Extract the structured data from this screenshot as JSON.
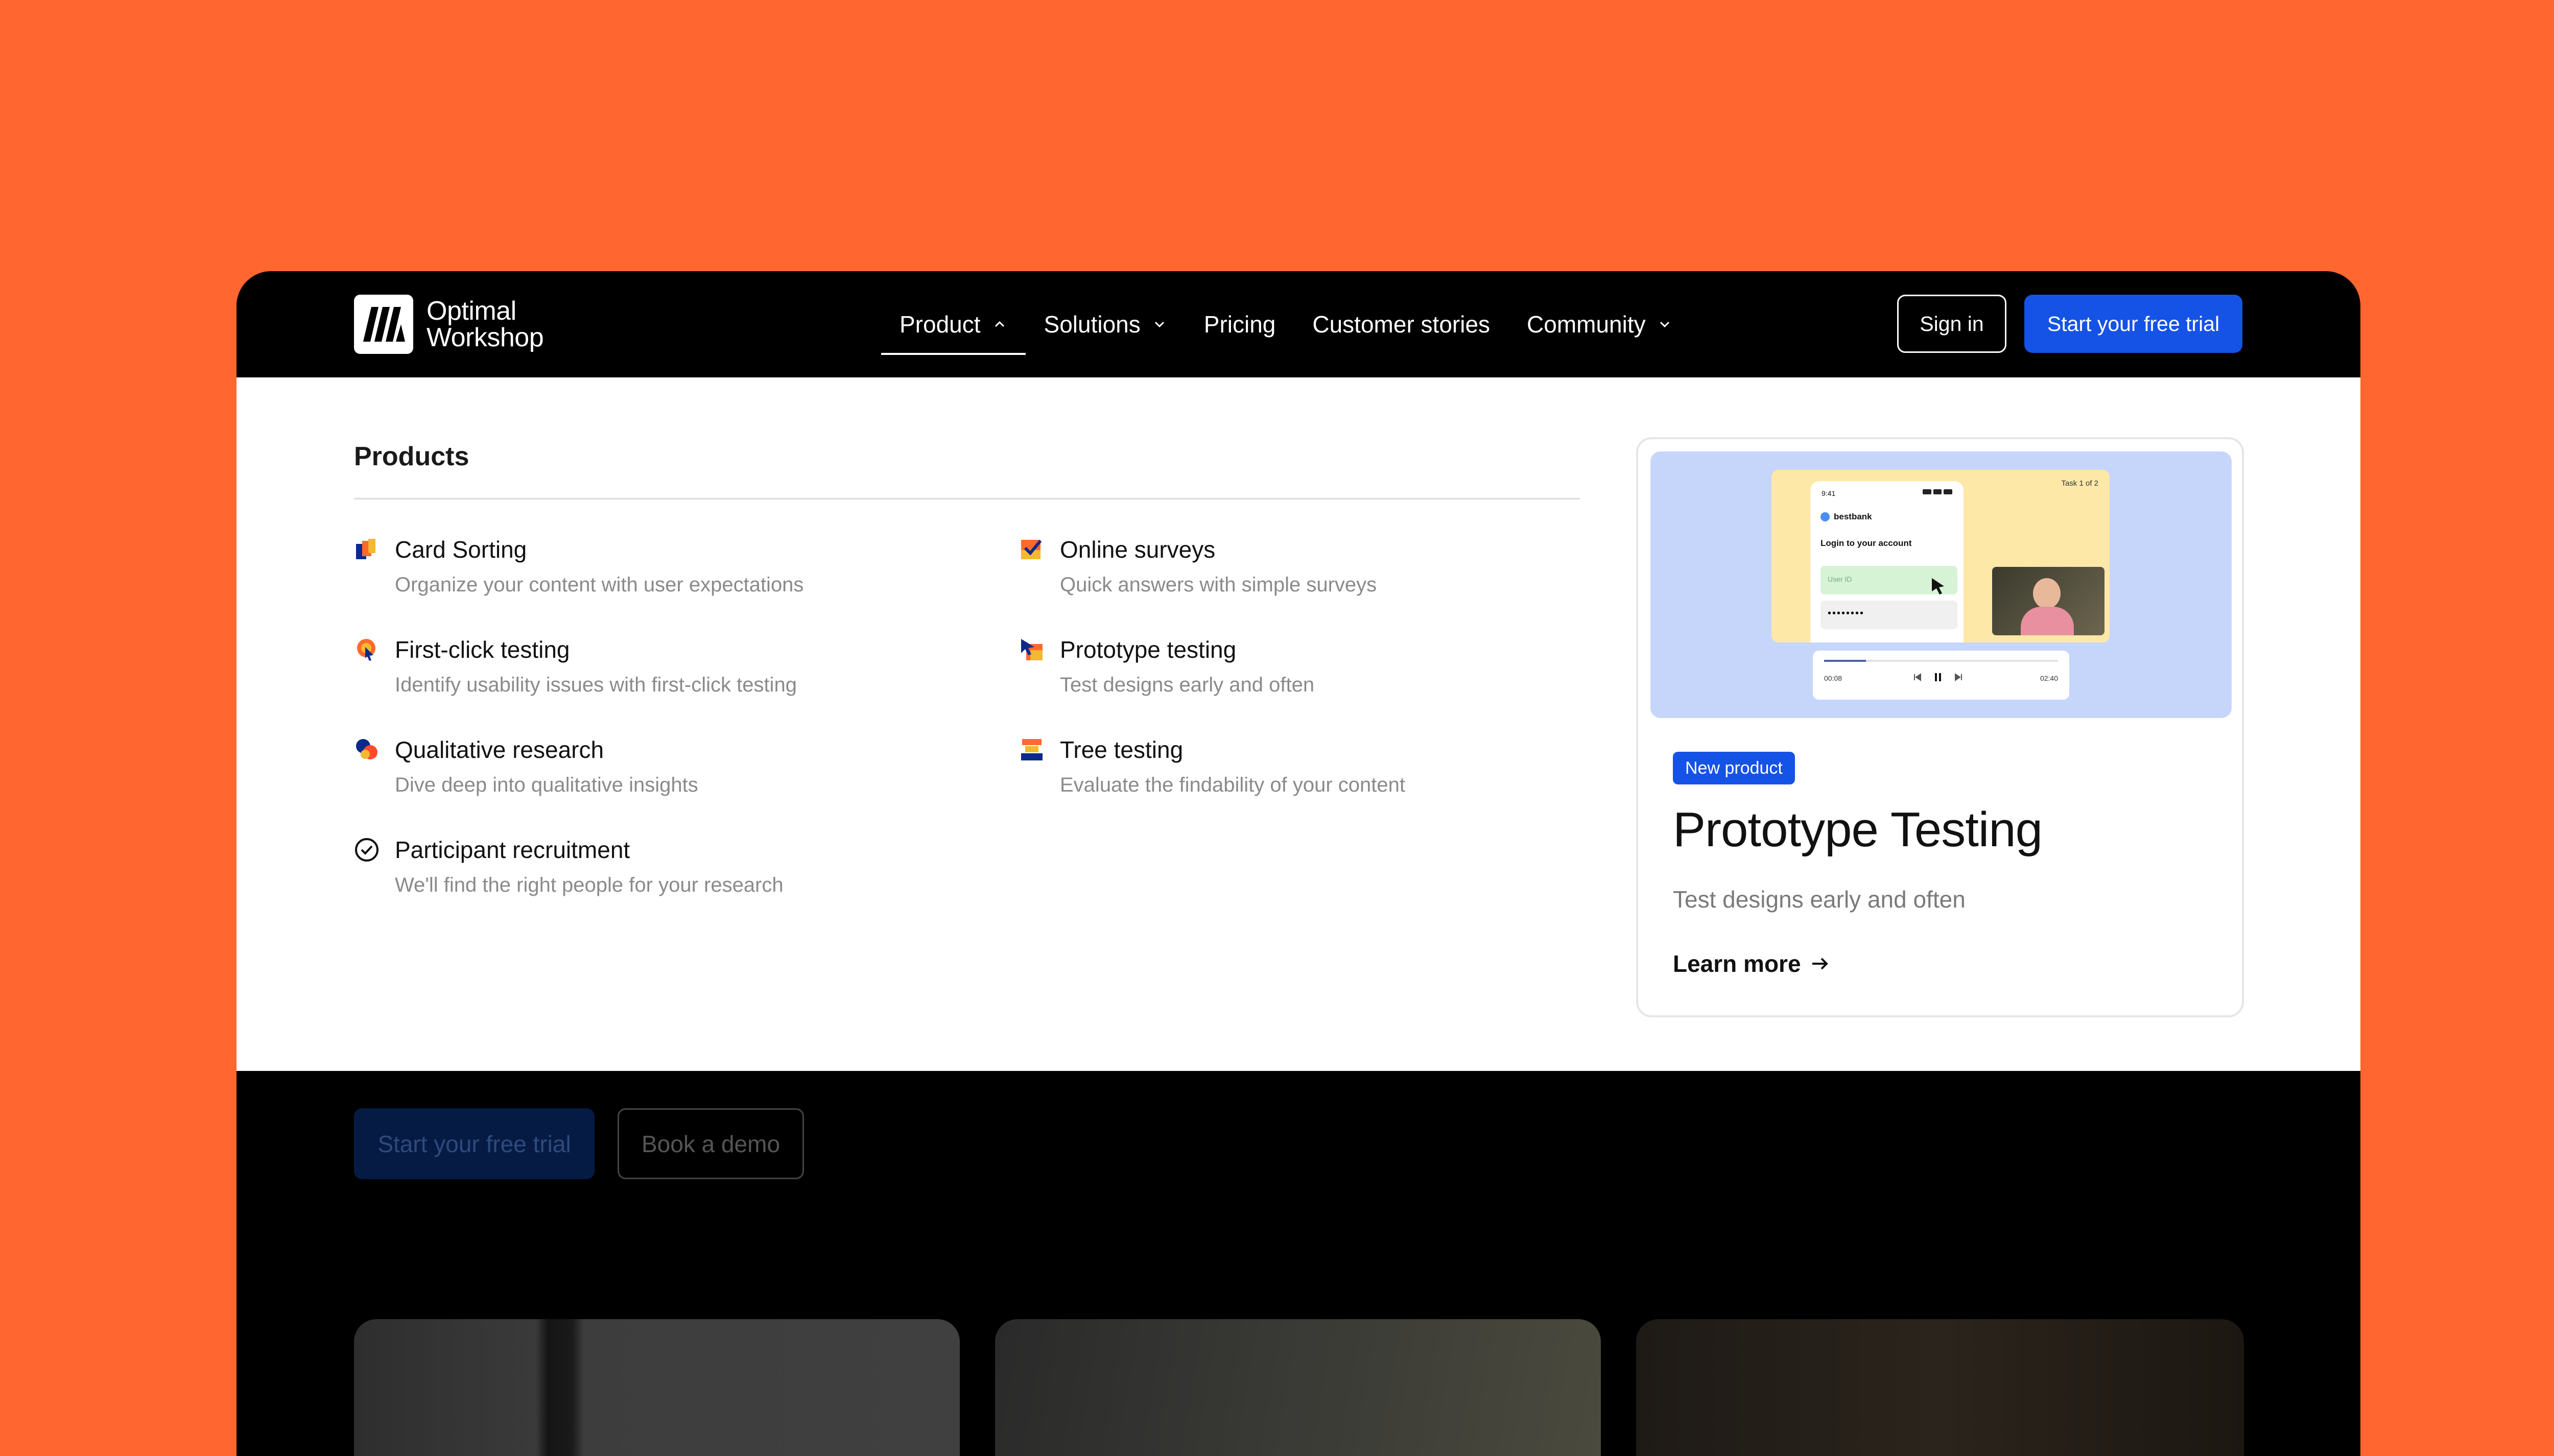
{
  "brand": {
    "name_line1": "Optimal",
    "name_line2": "Workshop"
  },
  "nav": {
    "items": [
      {
        "label": "Product",
        "has_dropdown": true,
        "active": true
      },
      {
        "label": "Solutions",
        "has_dropdown": true,
        "active": false
      },
      {
        "label": "Pricing",
        "has_dropdown": false,
        "active": false
      },
      {
        "label": "Customer stories",
        "has_dropdown": false,
        "active": false
      },
      {
        "label": "Community",
        "has_dropdown": true,
        "active": false
      }
    ],
    "sign_in": "Sign in",
    "free_trial": "Start your free trial"
  },
  "products_menu": {
    "heading": "Products",
    "items": [
      {
        "title": "Card Sorting",
        "desc": "Organize your content with user expectations",
        "icon": "card-sorting-icon"
      },
      {
        "title": "Online surveys",
        "desc": "Quick answers with simple surveys",
        "icon": "online-surveys-icon"
      },
      {
        "title": "First-click testing",
        "desc": "Identify usability issues with first-click testing",
        "icon": "first-click-icon"
      },
      {
        "title": "Prototype testing",
        "desc": "Test designs early and often",
        "icon": "prototype-testing-icon"
      },
      {
        "title": "Qualitative research",
        "desc": "Dive deep into qualitative insights",
        "icon": "qualitative-research-icon"
      },
      {
        "title": "Tree testing",
        "desc": "Evaluate the findability of your content",
        "icon": "tree-testing-icon"
      },
      {
        "title": "Participant recruitment",
        "desc": "We'll find the right people for your research",
        "icon": "check-circle-icon"
      }
    ],
    "feature_card": {
      "badge": "New product",
      "title": "Prototype Testing",
      "subtitle": "Test designs early and often",
      "link": "Learn more",
      "mock": {
        "time": "9:41",
        "task": "Task 1 of 2",
        "app_name": "bestbank",
        "login_text": "Login to your account",
        "user_placeholder": "User ID",
        "password_mask": "••••••••",
        "time_start": "00:08",
        "time_end": "02:40"
      }
    }
  },
  "hero": {
    "trial_button": "Start your free trial",
    "demo_button": "Book a demo"
  },
  "colors": {
    "background": "#ff6630",
    "accent": "#1553e6",
    "nav": "#000000"
  }
}
